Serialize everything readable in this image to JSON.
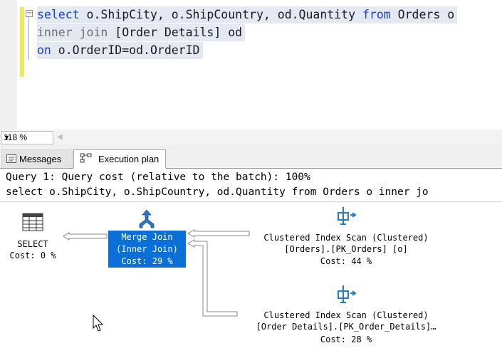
{
  "editor": {
    "lines": [
      [
        {
          "t": "select",
          "k": "kw"
        },
        {
          "t": " o.ShipCity, o.ShipCountry, od.Quantity "
        },
        {
          "t": "from",
          "k": "kw"
        },
        {
          "t": " Orders o"
        }
      ],
      [
        {
          "t": "inner join",
          "k": "gray"
        },
        {
          "t": " [Order Details] od"
        }
      ],
      [
        {
          "t": "on",
          "k": "kw"
        },
        {
          "t": " o.OrderID=od.OrderID"
        }
      ]
    ],
    "colors": {
      "keyword": "#1b3fd6",
      "join": "#6f6f6f",
      "line_bg": "#e3e8f1",
      "change_bar": "#f1e85a"
    }
  },
  "zoom": {
    "value": "118 %"
  },
  "tabs": [
    {
      "label": "Messages",
      "icon": "messages-icon",
      "active": false
    },
    {
      "label": "Execution plan",
      "icon": "execution-plan-icon",
      "active": true
    }
  ],
  "plan": {
    "query_header": "Query 1: Query cost (relative to the batch): 100%",
    "query_text": "select o.ShipCity, o.ShipCountry, od.Quantity from Orders o inner jo",
    "nodes": {
      "select": {
        "name": "SELECT",
        "cost": "Cost: 0 %",
        "icon": "select-result-icon"
      },
      "merge": {
        "name": "Merge Join",
        "sub": "(Inner Join)",
        "cost": "Cost: 29 %",
        "icon": "merge-join-icon",
        "selected": true,
        "highlight_color": "#0a6fd6"
      },
      "scan1": {
        "name": "Clustered Index Scan (Clustered)",
        "object": "[Orders].[PK_Orders] [o]",
        "cost": "Cost: 44 %",
        "icon": "clustered-index-scan-icon"
      },
      "scan2": {
        "name": "Clustered Index Scan (Clustered)",
        "object": "[Order Details].[PK_Order_Details]…",
        "cost": "Cost: 28 %",
        "icon": "clustered-index-scan-icon"
      }
    }
  }
}
